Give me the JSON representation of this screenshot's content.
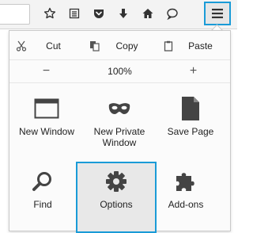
{
  "toolbar": {
    "buttons": [
      {
        "name": "bookmark-star-icon",
        "label": ""
      },
      {
        "name": "reading-list-icon",
        "label": ""
      },
      {
        "name": "pocket-icon",
        "label": ""
      },
      {
        "name": "download-icon",
        "label": ""
      },
      {
        "name": "home-icon",
        "label": ""
      },
      {
        "name": "chat-bubble-icon",
        "label": ""
      }
    ],
    "menu_icon": "hamburger-menu-icon"
  },
  "menu": {
    "edit": {
      "cut": "Cut",
      "copy": "Copy",
      "paste": "Paste"
    },
    "zoom": {
      "out": "−",
      "level": "100%",
      "in": "+"
    },
    "items": {
      "new_window": "New Window",
      "new_private_window_1": "New Private",
      "new_private_window_2": "Window",
      "save_page": "Save Page",
      "find": "Find",
      "options": "Options",
      "addons": "Add-ons"
    }
  },
  "colors": {
    "highlight": "#1a9bd7",
    "icon": "#555555"
  }
}
